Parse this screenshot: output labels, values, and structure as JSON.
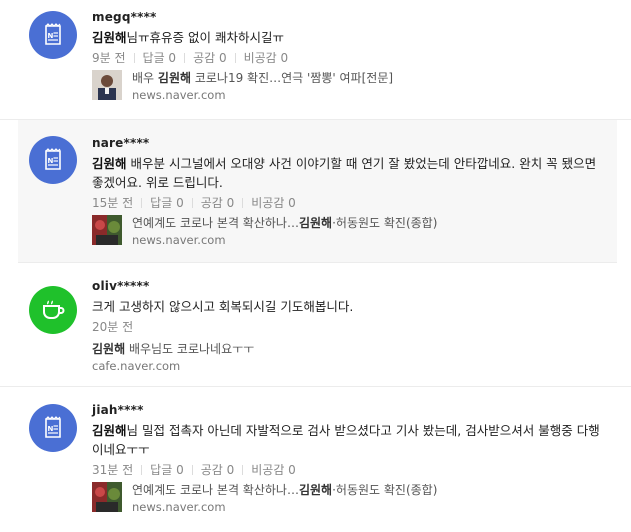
{
  "comments": [
    {
      "nick": "megq****",
      "avatar_icon": "news-document-icon",
      "avatar_color": "#4a6fd4",
      "highlight": "김원해",
      "text_rest": "님ㅠ휴유증 없이 쾌차하시길ㅠ",
      "time": "9분 전",
      "reply": "답글 0",
      "like": "공감 0",
      "dislike": "비공감 0",
      "news_pre": "배우 ",
      "news_highlight": "김원해",
      "news_post": " 코로나19 확진…연극 '짬뽕' 여파[전문]",
      "news_source": "news.naver.com"
    },
    {
      "nick": "nare****",
      "avatar_icon": "news-document-icon",
      "avatar_color": "#4a6fd4",
      "highlight": "김원해",
      "text_rest": " 배우분 시그널에서 오대양 사건 이야기할 때 연기 잘 봤었는데 안타깝네요. 완치 꼭 됐으면 좋겠어요. 위로 드립니다.",
      "time": "15분 전",
      "reply": "답글 0",
      "like": "공감 0",
      "dislike": "비공감 0",
      "news_pre": "연예계도 코로나 본격 확산하나…",
      "news_highlight": "김원해",
      "news_post": "·허동원도 확진(종합)",
      "news_source": "news.naver.com"
    },
    {
      "nick": "oliv*****",
      "avatar_icon": "cafe-cup-icon",
      "avatar_color": "#1fc12b",
      "text": "크게 고생하지 않으시고 회복되시길 기도해봅니다.",
      "time": "20분 전",
      "news_highlight": "김원해",
      "news_post": " 배우님도 코로나네요ㅜㅜ",
      "news_source": "cafe.naver.com"
    },
    {
      "nick": "jiah****",
      "avatar_icon": "news-document-icon",
      "avatar_color": "#4a6fd4",
      "highlight": "김원해",
      "text_rest": "님 밀접 접촉자 아닌데 자발적으로 검사 받으셨다고 기사 봤는데, 검사받으셔서 불행중 다행이네요ㅜㅜ",
      "time": "31분 전",
      "reply": "답글 0",
      "like": "공감 0",
      "dislike": "비공감 0",
      "news_pre": "연예계도 코로나 본격 확산하나…",
      "news_highlight": "김원해",
      "news_post": "·허동원도 확진(종합)",
      "news_source": "news.naver.com"
    }
  ]
}
